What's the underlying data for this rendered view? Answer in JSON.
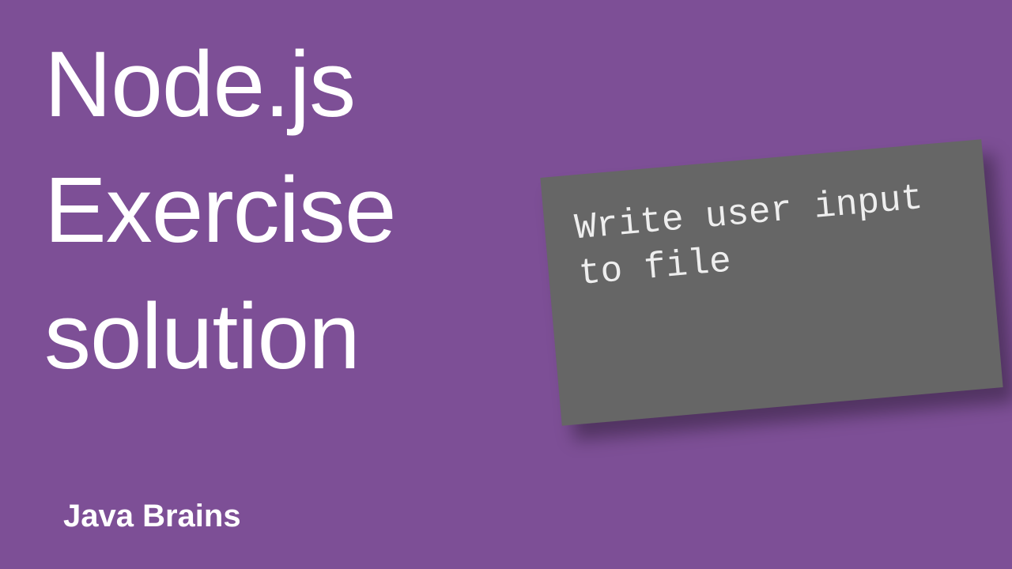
{
  "title_lines": {
    "line1": "Node.js",
    "line2": "Exercise",
    "line3": "solution"
  },
  "card": {
    "line1": "Write user input",
    "line2": "to file"
  },
  "brand": "Java Brains",
  "colors": {
    "background": "#7d4f96",
    "card_bg": "#666666",
    "text": "#ffffff",
    "card_text": "#eeeeee"
  }
}
